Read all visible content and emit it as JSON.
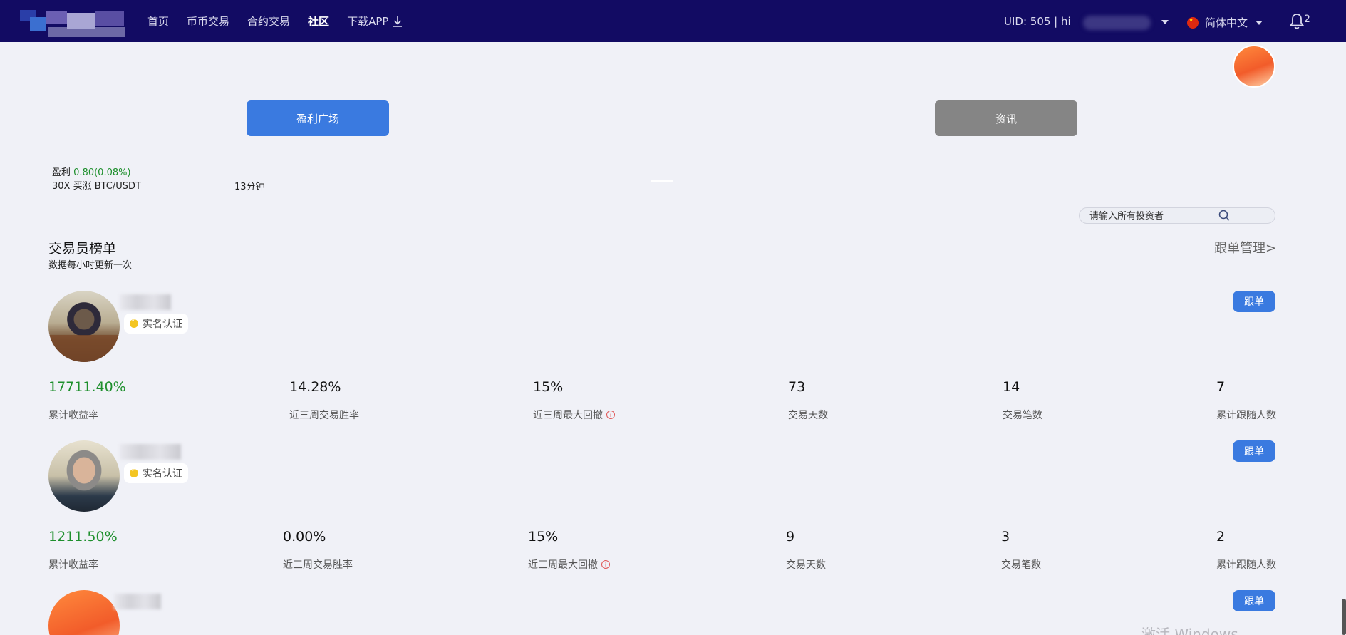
{
  "header": {
    "nav": [
      {
        "label": "首页",
        "active": false
      },
      {
        "label": "币币交易",
        "active": false
      },
      {
        "label": "合约交易",
        "active": false
      },
      {
        "label": "社区",
        "active": true
      },
      {
        "label": "下载APP",
        "active": false
      }
    ],
    "uid": "UID: 505  |  hi",
    "language": "简体中文",
    "notification_count": "2"
  },
  "tabs": {
    "profit_square": "盈利广场",
    "news": "资讯"
  },
  "ticker": {
    "profit_label": "盈利",
    "profit_value": "0.80(0.08%)",
    "trade": "30X 买涨 BTC/USDT",
    "time": "13分钟"
  },
  "search": {
    "placeholder": "请输入所有投资者"
  },
  "ranking": {
    "title": "交易员榜单",
    "subtitle": "数据每小时更新一次",
    "manage_link": "跟单管理>",
    "verified_label": "实名认证",
    "follow_label": "跟单",
    "labels": {
      "total_return": "累计收益率",
      "win_rate": "近三周交易胜率",
      "max_drawdown": "近三周最大回撤",
      "trade_days": "交易天数",
      "trade_count": "交易笔数",
      "followers": "累计跟随人数"
    },
    "traders": [
      {
        "total_return": "17711.40%",
        "win_rate": "14.28%",
        "max_drawdown": "15%",
        "trade_days": "73",
        "trade_count": "14",
        "followers": "7"
      },
      {
        "total_return": "1211.50%",
        "win_rate": "0.00%",
        "max_drawdown": "15%",
        "trade_days": "9",
        "trade_count": "3",
        "followers": "2"
      }
    ]
  },
  "watermark": "激活 Windows",
  "colors": {
    "header_bg": "#120b63",
    "accent_blue": "#3a7ae0",
    "profit_green": "#1e8f2d",
    "news_gray": "#858585"
  }
}
